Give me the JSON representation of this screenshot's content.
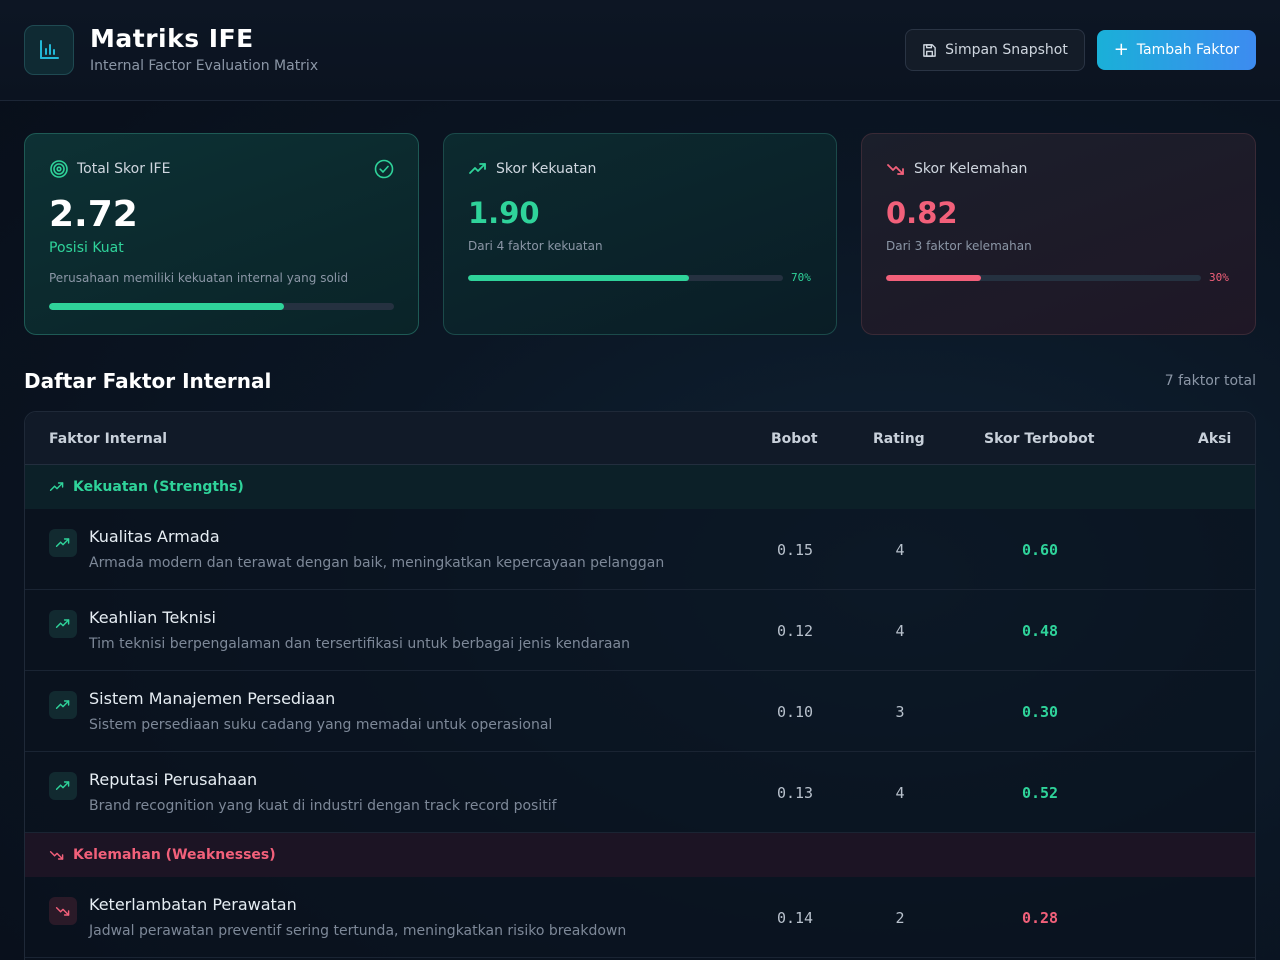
{
  "header": {
    "title": "Matriks IFE",
    "subtitle": "Internal Factor Evaluation Matrix",
    "snapshot_label": "Simpan Snapshot",
    "add_label": "Tambah Faktor"
  },
  "cards": {
    "ife": {
      "label": "Total Skor IFE",
      "value": "2.72",
      "position": "Posisi Kuat",
      "description": "Perusahaan memiliki kekuatan internal yang solid",
      "progress": 0.68
    },
    "strength": {
      "label": "Skor Kekuatan",
      "value": "1.90",
      "description": "Dari 4 faktor kekuatan",
      "percent_text": "70%",
      "progress": 0.7
    },
    "weakness": {
      "label": "Skor Kelemahan",
      "value": "0.82",
      "description": "Dari 3 faktor kelemahan",
      "percent_text": "30%",
      "progress": 0.3
    }
  },
  "section": {
    "title": "Daftar Faktor Internal",
    "count": "7 faktor total"
  },
  "table": {
    "headers": {
      "factor": "Faktor Internal",
      "weight": "Bobot",
      "rating": "Rating",
      "score": "Skor Terbobot",
      "action": "Aksi"
    },
    "strength_group": "Kekuatan (Strengths)",
    "weakness_group": "Kelemahan (Weaknesses)",
    "strengths": [
      {
        "name": "Kualitas Armada",
        "desc": "Armada modern dan terawat dengan baik, meningkatkan kepercayaan pelanggan",
        "weight": "0.15",
        "rating": "4",
        "score": "0.60"
      },
      {
        "name": "Keahlian Teknisi",
        "desc": "Tim teknisi berpengalaman dan tersertifikasi untuk berbagai jenis kendaraan",
        "weight": "0.12",
        "rating": "4",
        "score": "0.48"
      },
      {
        "name": "Sistem Manajemen Persediaan",
        "desc": "Sistem persediaan suku cadang yang memadai untuk operasional",
        "weight": "0.10",
        "rating": "3",
        "score": "0.30"
      },
      {
        "name": "Reputasi Perusahaan",
        "desc": "Brand recognition yang kuat di industri dengan track record positif",
        "weight": "0.13",
        "rating": "4",
        "score": "0.52"
      }
    ],
    "weaknesses": [
      {
        "name": "Keterlambatan Perawatan",
        "desc": "Jadwal perawatan preventif sering tertunda, meningkatkan risiko breakdown",
        "weight": "0.14",
        "rating": "2",
        "score": "0.28"
      }
    ]
  },
  "colors": {
    "strength": "#2fd39a",
    "weakness": "#f2607a",
    "accent": "#1ab0d8"
  }
}
